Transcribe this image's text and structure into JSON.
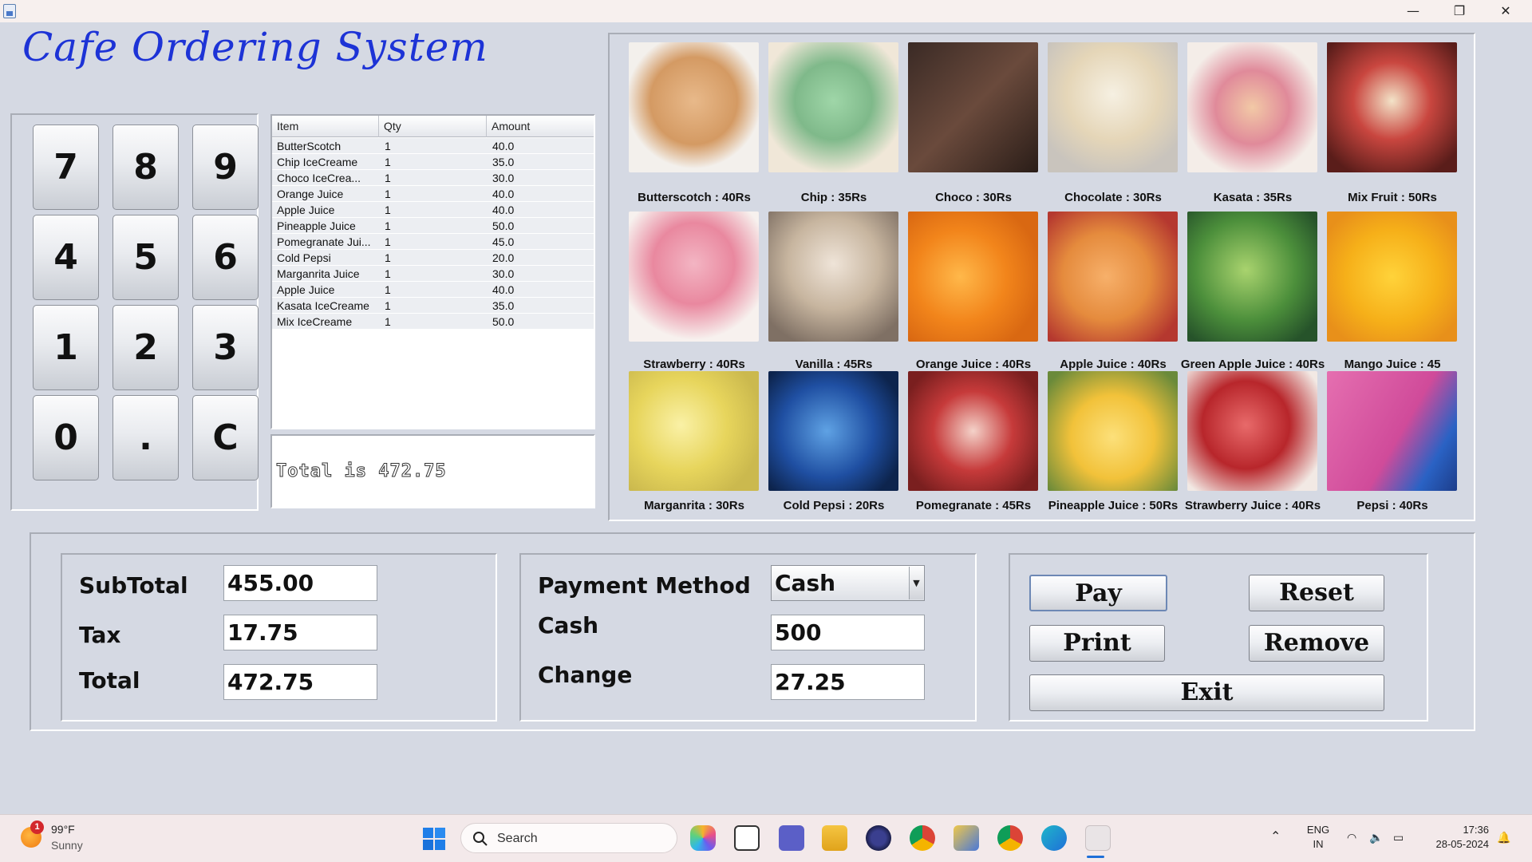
{
  "window": {
    "minimize_glyph": "—",
    "maximize_glyph": "❐",
    "close_glyph": "✕"
  },
  "app_title": "Cafe Ordering System",
  "keypad": {
    "keys": [
      "7",
      "8",
      "9",
      "4",
      "5",
      "6",
      "1",
      "2",
      "3",
      "0",
      ".",
      "C"
    ]
  },
  "order_table": {
    "headers": [
      "Item",
      "Qty",
      "Amount"
    ],
    "rows": [
      {
        "item": "ButterScotch",
        "qty": "1",
        "amount": "40.0"
      },
      {
        "item": "Chip IceCreame",
        "qty": "1",
        "amount": "35.0"
      },
      {
        "item": "Choco IceCrea...",
        "qty": "1",
        "amount": "30.0"
      },
      {
        "item": "Orange Juice",
        "qty": "1",
        "amount": "40.0"
      },
      {
        "item": "Apple Juice",
        "qty": "1",
        "amount": "40.0"
      },
      {
        "item": "Pineapple Juice",
        "qty": "1",
        "amount": "50.0"
      },
      {
        "item": "Pomegranate Jui...",
        "qty": "1",
        "amount": "45.0"
      },
      {
        "item": "Cold Pepsi",
        "qty": "1",
        "amount": "20.0"
      },
      {
        "item": "Marganrita Juice",
        "qty": "1",
        "amount": "30.0"
      },
      {
        "item": "Apple Juice",
        "qty": "1",
        "amount": "40.0"
      },
      {
        "item": "Kasata IceCreame",
        "qty": "1",
        "amount": "35.0"
      },
      {
        "item": "Mix IceCreame",
        "qty": "1",
        "amount": "50.0"
      }
    ]
  },
  "total_display": "Total is 472.75",
  "menu": {
    "items": [
      {
        "label": "Butterscotch : 40Rs",
        "icon": "butterscotch-image"
      },
      {
        "label": "Chip : 35Rs",
        "icon": "chip-icecream-image"
      },
      {
        "label": "Choco : 30Rs",
        "icon": "choco-bar-image"
      },
      {
        "label": "Chocolate : 30Rs",
        "icon": "chocolate-sundae-image"
      },
      {
        "label": "Kasata : 35Rs",
        "icon": "kasata-image"
      },
      {
        "label": "Mix Fruit : 50Rs",
        "icon": "mix-fruit-image"
      },
      {
        "label": "Strawberry : 40Rs",
        "icon": "strawberry-icecream-image"
      },
      {
        "label": "Vanilla : 45Rs",
        "icon": "vanilla-cones-image"
      },
      {
        "label": "Orange Juice : 40Rs",
        "icon": "orange-juice-image"
      },
      {
        "label": "Apple Juice : 40Rs",
        "icon": "apple-juice-image"
      },
      {
        "label": "Green Apple Juice : 40Rs",
        "icon": "green-apple-juice-image"
      },
      {
        "label": "Mango Juice : 45",
        "icon": "mango-juice-image"
      },
      {
        "label": "Marganrita : 30Rs",
        "icon": "margarita-image"
      },
      {
        "label": "Cold Pepsi : 20Rs",
        "icon": "cold-pepsi-image"
      },
      {
        "label": "Pomegranate : 45Rs",
        "icon": "pomegranate-image"
      },
      {
        "label": "Pineapple Juice : 50Rs",
        "icon": "pineapple-juice-image"
      },
      {
        "label": "Strawberry Juice : 40Rs",
        "icon": "strawberry-juice-image"
      },
      {
        "label": "Pepsi : 40Rs",
        "icon": "pepsi-can-image"
      }
    ]
  },
  "totals": {
    "subtotal_label": "SubTotal",
    "subtotal_value": "455.00",
    "tax_label": "Tax",
    "tax_value": "17.75",
    "total_label": "Total",
    "total_value": "472.75"
  },
  "payment": {
    "method_label": "Payment Method",
    "method_value": "Cash",
    "cash_label": "Cash",
    "cash_value": "500",
    "change_label": "Change",
    "change_value": "27.25"
  },
  "actions": {
    "pay": "Pay",
    "reset": "Reset",
    "print": "Print",
    "remove": "Remove",
    "exit": "Exit"
  },
  "taskbar": {
    "weather_temp": "99°F",
    "weather_cond": "Sunny",
    "weather_badge": "1",
    "search_placeholder": "Search",
    "lang_line1": "ENG",
    "lang_line2": "IN",
    "time": "17:36",
    "date": "28-05-2024"
  }
}
